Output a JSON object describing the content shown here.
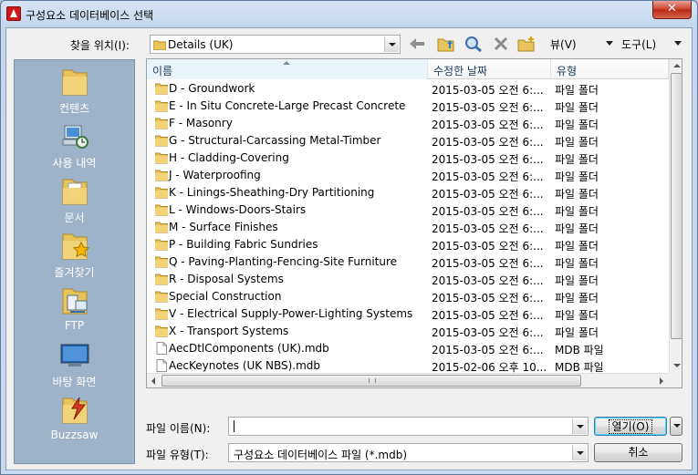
{
  "window": {
    "title": "구성요소 데이터베이스 선택",
    "close_label": "✕"
  },
  "toolbar": {
    "lookin_label": "찾을 위치(I):",
    "lookin_value": "Details (UK)",
    "views_label": "뷰(V)",
    "tools_label": "도구(L)"
  },
  "places": [
    {
      "label": "컨텐츠",
      "icon": "folder-icon"
    },
    {
      "label": "사용 내역",
      "icon": "history-icon"
    },
    {
      "label": "문서",
      "icon": "documents-icon"
    },
    {
      "label": "즐겨찾기",
      "icon": "favorites-icon"
    },
    {
      "label": "FTP",
      "icon": "ftp-icon"
    },
    {
      "label": "바탕 화면",
      "icon": "desktop-icon"
    },
    {
      "label": "Buzzsaw",
      "icon": "buzzsaw-icon"
    }
  ],
  "columns": {
    "name": "이름",
    "date": "수정한 날짜",
    "type": "유형"
  },
  "files": [
    {
      "name": "D - Groundwork",
      "date": "2015-03-05 오전 6:...",
      "type": "파일 폴더",
      "kind": "folder"
    },
    {
      "name": "E - In Situ Concrete-Large Precast Concrete",
      "date": "2015-03-05 오전 6:...",
      "type": "파일 폴더",
      "kind": "folder"
    },
    {
      "name": "F - Masonry",
      "date": "2015-03-05 오전 6:...",
      "type": "파일 폴더",
      "kind": "folder"
    },
    {
      "name": "G - Structural-Carcassing Metal-Timber",
      "date": "2015-03-05 오전 6:...",
      "type": "파일 폴더",
      "kind": "folder"
    },
    {
      "name": "H - Cladding-Covering",
      "date": "2015-03-05 오전 6:...",
      "type": "파일 폴더",
      "kind": "folder"
    },
    {
      "name": "J - Waterproofing",
      "date": "2015-03-05 오전 6:...",
      "type": "파일 폴더",
      "kind": "folder"
    },
    {
      "name": "K - Linings-Sheathing-Dry Partitioning",
      "date": "2015-03-05 오전 6:...",
      "type": "파일 폴더",
      "kind": "folder"
    },
    {
      "name": "L - Windows-Doors-Stairs",
      "date": "2015-03-05 오전 6:...",
      "type": "파일 폴더",
      "kind": "folder"
    },
    {
      "name": "M - Surface Finishes",
      "date": "2015-03-05 오전 6:...",
      "type": "파일 폴더",
      "kind": "folder"
    },
    {
      "name": "P - Building Fabric Sundries",
      "date": "2015-03-05 오전 6:...",
      "type": "파일 폴더",
      "kind": "folder"
    },
    {
      "name": "Q - Paving-Planting-Fencing-Site Furniture",
      "date": "2015-03-05 오전 6:...",
      "type": "파일 폴더",
      "kind": "folder"
    },
    {
      "name": "R - Disposal Systems",
      "date": "2015-03-05 오전 6:...",
      "type": "파일 폴더",
      "kind": "folder"
    },
    {
      "name": "Special Construction",
      "date": "2015-03-05 오전 6:...",
      "type": "파일 폴더",
      "kind": "folder"
    },
    {
      "name": "V - Electrical Supply-Power-Lighting Systems",
      "date": "2015-03-05 오전 6:...",
      "type": "파일 폴더",
      "kind": "folder"
    },
    {
      "name": "X - Transport Systems",
      "date": "2015-03-05 오전 6:...",
      "type": "파일 폴더",
      "kind": "folder"
    },
    {
      "name": "AecDtlComponents (UK).mdb",
      "date": "2015-03-05 오전 6:...",
      "type": "MDB 파일",
      "kind": "file"
    },
    {
      "name": "AecKeynotes (UK NBS).mdb",
      "date": "2015-02-06 오후 10...",
      "type": "MDB 파일",
      "kind": "file"
    }
  ],
  "footer": {
    "filename_label": "파일 이름(N):",
    "filename_value": "",
    "filetype_label": "파일 유형(T):",
    "filetype_value": "구성요소 데이터베이스 파일 (*.mdb)",
    "open_label": "열기(O)",
    "cancel_label": "취소"
  },
  "colors": {
    "folder": "#e8c25a",
    "places_bg": "#9cb3c9",
    "close": "#c8402a"
  }
}
